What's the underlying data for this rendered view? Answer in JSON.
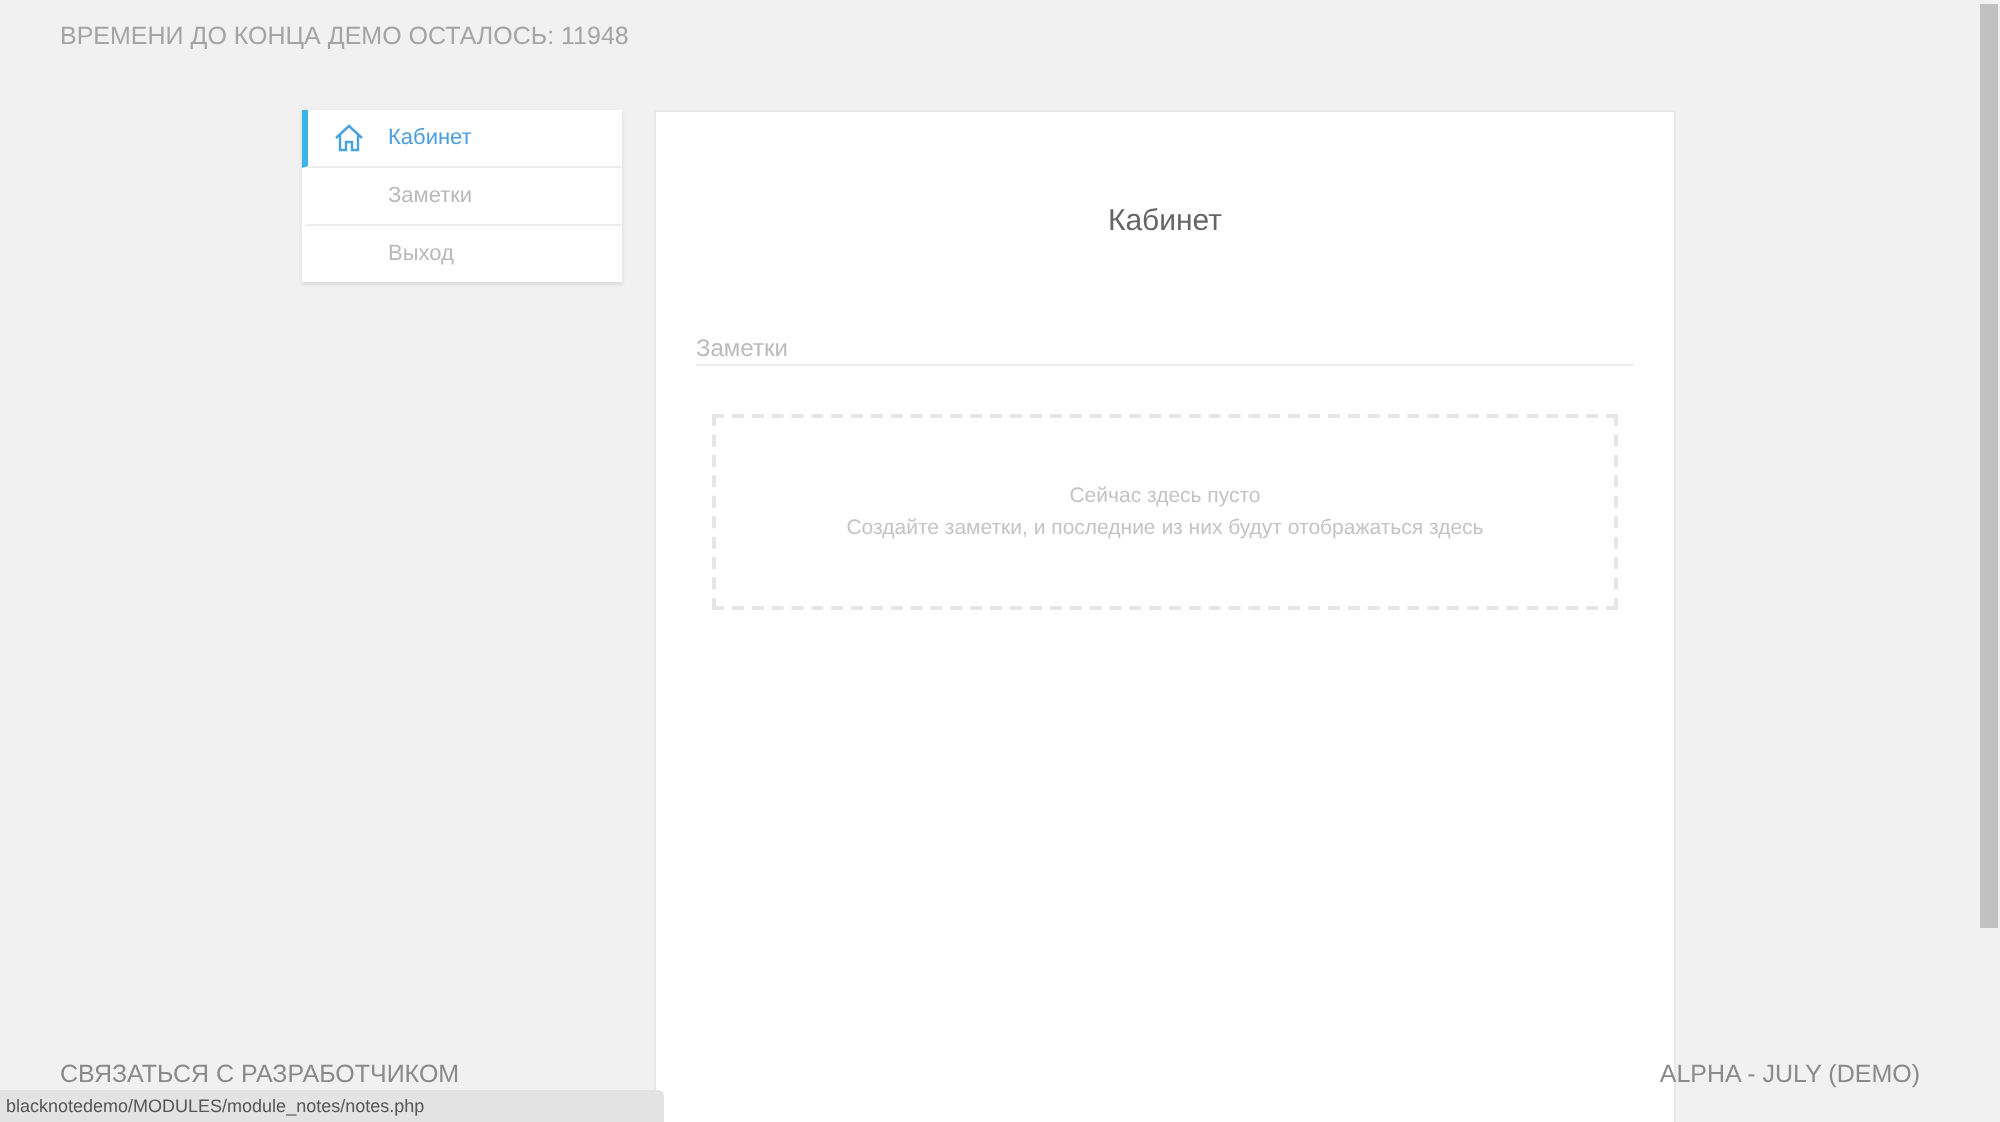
{
  "demo_notice": "ВРЕМЕНИ ДО КОНЦА ДЕМО ОСТАЛОСЬ: 11948",
  "sidebar": {
    "items": [
      {
        "label": "Кабинет",
        "selected": true,
        "kind": "home"
      },
      {
        "label": "Заметки",
        "selected": false,
        "kind": "plain"
      },
      {
        "label": "Выход",
        "selected": false,
        "kind": "plain"
      }
    ]
  },
  "main": {
    "title": "Кабинет",
    "section": "Заметки",
    "empty_title": "Сейчас здесь пусто",
    "empty_text": "Создайте заметки, и последние из них будут отображаться здесь"
  },
  "footer": {
    "contact": "СВЯЗАТЬСЯ С РАЗРАБОТЧИКОМ",
    "version": "ALPHA - JULY (DEMO)"
  },
  "status_url": "blacknotedemo/MODULES/module_notes/notes.php"
}
